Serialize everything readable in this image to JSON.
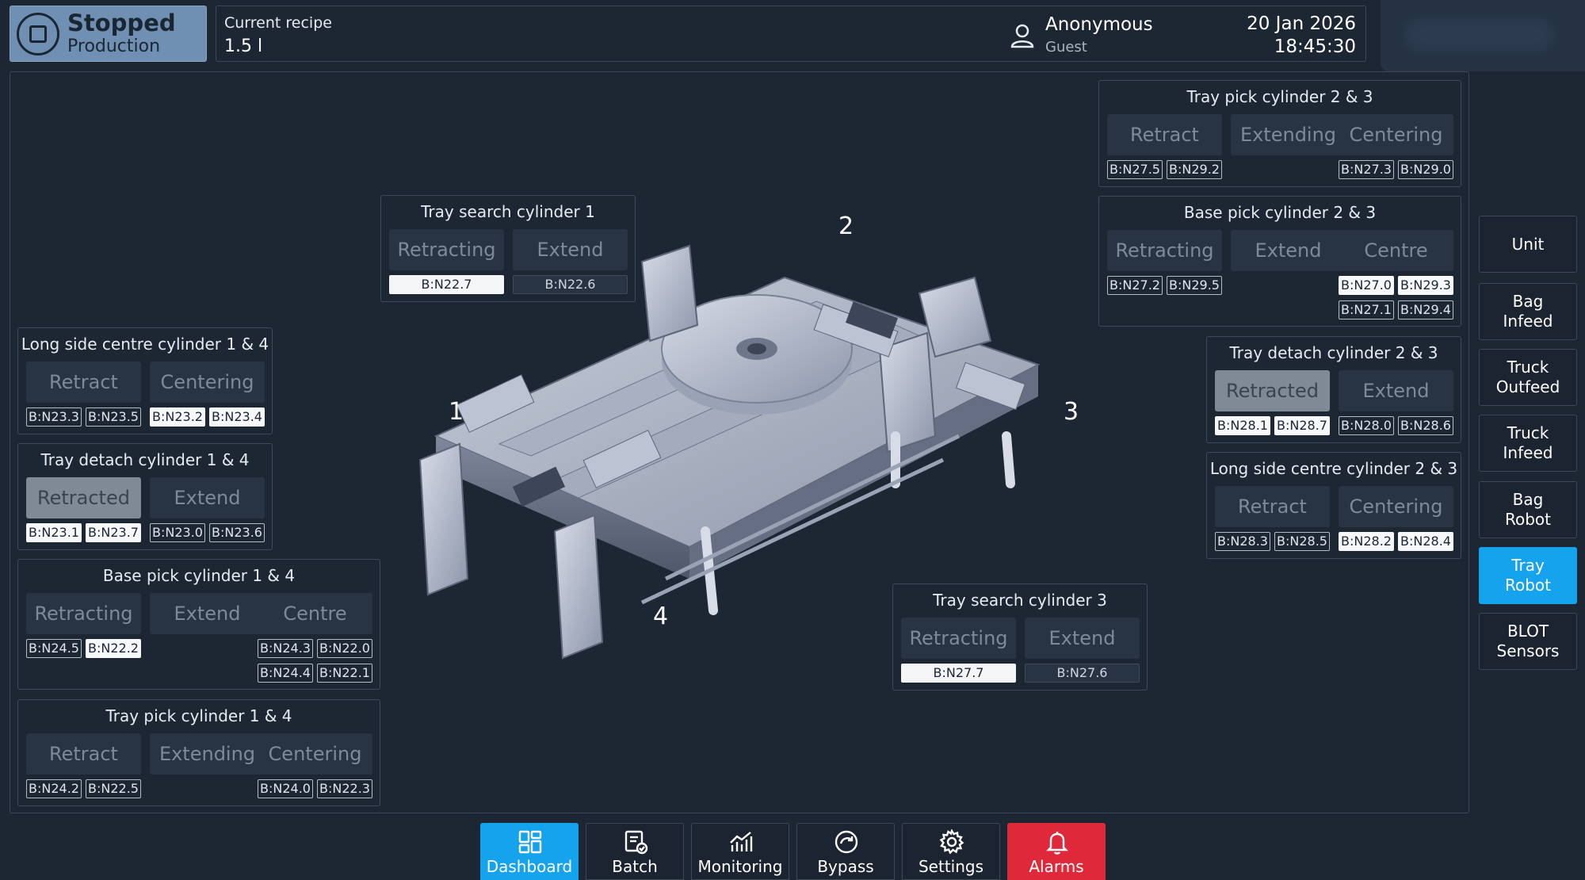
{
  "status": {
    "state": "Stopped",
    "mode": "Production"
  },
  "recipe": {
    "label": "Current recipe",
    "value": "1.5 l"
  },
  "user": {
    "name": "Anonymous",
    "role": "Guest"
  },
  "datetime": {
    "date": "20 Jan 2026",
    "time": "18:45:30"
  },
  "machine_labels": [
    "1",
    "2",
    "3",
    "4"
  ],
  "cylinders": {
    "long_side_centre_1_4": {
      "title": "Long side centre cylinder 1 & 4",
      "buttons": [
        "Retract",
        "Centering"
      ],
      "tags": [
        "B:N23.3",
        "B:N23.5",
        "B:N23.2",
        "B:N23.4"
      ]
    },
    "tray_detach_1_4": {
      "title": "Tray detach cylinder 1 & 4",
      "buttons": [
        "Retracted",
        "Extend"
      ],
      "tags": [
        "B:N23.1",
        "B:N23.7",
        "B:N23.0",
        "B:N23.6"
      ]
    },
    "base_pick_1_4": {
      "title": "Base pick cylinder 1 & 4",
      "buttons": [
        "Retracting",
        "Extend",
        "Centre"
      ],
      "tags": [
        "B:N24.5",
        "B:N22.2",
        "B:N24.3",
        "B:N22.0",
        "B:N24.4",
        "B:N22.1"
      ]
    },
    "tray_pick_1_4": {
      "title": "Tray pick cylinder 1 & 4",
      "buttons": [
        "Retract",
        "Extending",
        "Centering"
      ],
      "tags": [
        "B:N24.2",
        "B:N22.5",
        "B:N24.0",
        "B:N22.3"
      ]
    },
    "tray_search_1": {
      "title": "Tray search cylinder 1",
      "buttons": [
        "Retracting",
        "Extend"
      ],
      "tags": [
        "B:N22.7",
        "B:N22.6"
      ]
    },
    "tray_search_3": {
      "title": "Tray search cylinder 3",
      "buttons": [
        "Retracting",
        "Extend"
      ],
      "tags": [
        "B:N27.7",
        "B:N27.6"
      ]
    },
    "tray_pick_2_3": {
      "title": "Tray pick cylinder 2 & 3",
      "buttons": [
        "Retract",
        "Extending",
        "Centering"
      ],
      "tags": [
        "B:N27.5",
        "B:N29.2",
        "B:N27.3",
        "B:N29.0"
      ]
    },
    "base_pick_2_3": {
      "title": "Base pick cylinder 2 & 3",
      "buttons": [
        "Retracting",
        "Extend",
        "Centre"
      ],
      "tags": [
        "B:N27.2",
        "B:N29.5",
        "B:N27.0",
        "B:N29.3",
        "B:N27.1",
        "B:N29.4"
      ]
    },
    "tray_detach_2_3": {
      "title": "Tray detach cylinder 2 & 3",
      "buttons": [
        "Retracted",
        "Extend"
      ],
      "tags": [
        "B:N28.1",
        "B:N28.7",
        "B:N28.0",
        "B:N28.6"
      ]
    },
    "long_side_centre_2_3": {
      "title": "Long side centre cylinder 2 & 3",
      "buttons": [
        "Retract",
        "Centering"
      ],
      "tags": [
        "B:N28.3",
        "B:N28.5",
        "B:N28.2",
        "B:N28.4"
      ]
    }
  },
  "side_nav": [
    "Unit",
    "Bag\nInfeed",
    "Truck\nOutfeed",
    "Truck\nInfeed",
    "Bag\nRobot",
    "Tray\nRobot",
    "BLOT\nSensors"
  ],
  "side_nav_active": "Tray\nRobot",
  "bottom_nav": [
    "Dashboard",
    "Batch",
    "Monitoring",
    "Bypass",
    "Settings",
    "Alarms"
  ],
  "bottom_nav_active": "Dashboard",
  "icons": {
    "status": "stop-icon",
    "user": "user-icon",
    "dashboard": "grid-icon",
    "batch": "clipboard-check-icon",
    "monitoring": "chart-icon",
    "bypass": "bypass-icon",
    "settings": "gear-icon",
    "alarms": "bell-icon"
  },
  "colors": {
    "accent": "#15a3ee",
    "alarm": "#e0283b",
    "status": "#6f8fb3",
    "background": "#1d2734"
  }
}
